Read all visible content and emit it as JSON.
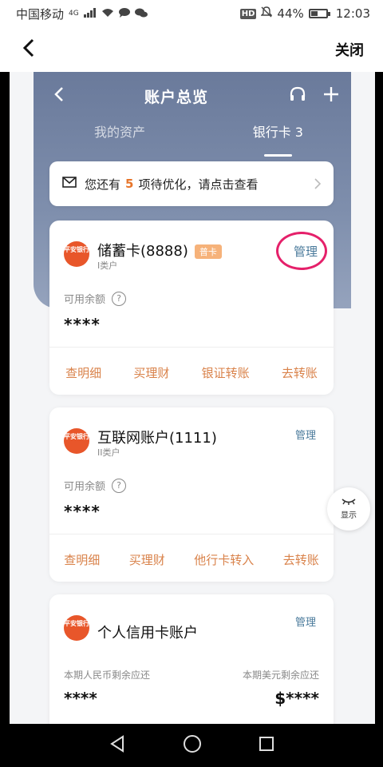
{
  "status_bar": {
    "carrier": "中国移动",
    "network": "4G",
    "hd": "HD",
    "battery": "44%",
    "battery_level": 0.44,
    "time": "12:03"
  },
  "nav": {
    "close_label": "关闭"
  },
  "hero": {
    "title": "账户总览",
    "tabs": [
      "我的资产",
      "银行卡 3"
    ]
  },
  "notice": {
    "prefix": "您还有",
    "count": "5",
    "suffix": "项待优化，请点击查看"
  },
  "cards": [
    {
      "logo": "平安银行",
      "name": "储蓄卡(8888)",
      "tag": "普卡",
      "sub": "I类户",
      "manage": "管理",
      "balance_label": "可用余额",
      "balance": "****",
      "actions": [
        "查明细",
        "买理财",
        "银证转账",
        "去转账"
      ]
    },
    {
      "logo": "平安银行",
      "name": "互联网账户(1111)",
      "sub": "II类户",
      "manage": "管理",
      "balance_label": "可用余额",
      "balance": "****",
      "actions": [
        "查明细",
        "买理财",
        "他行卡转入",
        "去转账"
      ]
    },
    {
      "logo": "平安银行",
      "name": "个人信用卡账户",
      "manage": "管理",
      "rmb_label": "本期人民币剩余应还",
      "usd_label": "本期美元剩余应还",
      "rmb_value": "****",
      "usd_value": "$****"
    }
  ],
  "fab": {
    "label": "显示",
    "icon": "eye-closed-icon"
  },
  "colors": {
    "accent": "#e7752a",
    "hero": "#7f8fad",
    "manage": "#4a7a9b",
    "action": "#d9824a",
    "highlight_circle": "#e5206a"
  }
}
